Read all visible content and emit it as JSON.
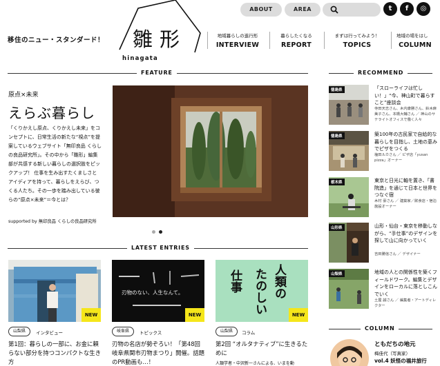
{
  "header": {
    "tagline": "移住のニュー・スタンダード！",
    "logo_text": "雛形",
    "logo_sub": "hinagata",
    "top_buttons": {
      "about": "ABOUT",
      "area": "AREA"
    },
    "social": {
      "twitter": "t",
      "facebook": "f",
      "other": "◎"
    },
    "nav": [
      {
        "sub": "地域暮らしの進行形",
        "label": "INTERVIEW"
      },
      {
        "sub": "暮らしたくなる",
        "label": "REPORT"
      },
      {
        "sub": "まずは行ってみよう！",
        "label": "TOPICS"
      },
      {
        "sub": "地域の場をはし",
        "label": "COLUMN"
      }
    ]
  },
  "feature": {
    "section_title": "FEATURE",
    "kicker": "原点×未来",
    "title": "えらぶ暮らし",
    "body": "「くりかえし原点、くりかえし未来」をコンセプトに、日常生活の新たな“視点”を提案しているウェブサイト「無印良品 くらしの良品研究所」。その中から「雛形」編集部が共感する新しい暮らしの選択肢をピックアップ！ 仕事を生み出すたくましさとアイディアを持って、暮らしをえらび、つくる人たち。その一歩を踏み出している彼らの“原点×未来”＝今とは？",
    "supported": "supported by 無印良品 くらしの良品研究所",
    "slide_count": 2,
    "active_slide": 2
  },
  "latest": {
    "section_title": "LATEST ENTRIES",
    "entries": [
      {
        "area": "山梨県",
        "category": "インタビュー",
        "title": "第1回：暮らしの一部に、お金に頼らない部分を持つコンパクトな生き方",
        "badge": "NEW"
      },
      {
        "area": "岐阜県",
        "category": "トピックス",
        "title": "刃物の名店が勢ぞろい！「第48回岐阜県関市刃物まつり」開催。話題のPR動画も…！",
        "badge": "NEW",
        "image_caption": "刃物のない、人生なんて。"
      },
      {
        "area": "山梨県",
        "category": "コラム",
        "title": "第2回 “オルタナティブ”に生きるために",
        "meta": "人類学者・中沢新一さんによる、いまを動",
        "badge": "NEW",
        "image_text": [
          "仕事",
          "人類の",
          "たのしい"
        ]
      }
    ]
  },
  "recommend": {
    "section_title": "RECOMMEND",
    "items": [
      {
        "area": "徳島県",
        "title": "「スローライフは忙しい！」“今、神山町で暮らすこと”座談会",
        "meta": "寺田天志さん、木内康勝さん、鈴木麻美子さん、本橋大輔さん ／ 神山のサテライトオフィスで働く人々"
      },
      {
        "area": "徳島県",
        "title": "築100年の古民家で自給的な暮らしを目指し、土地の恵みでピザをつくる",
        "meta": "塩田ルカさん ／ ピザ店「yusan pizza」オーナー"
      },
      {
        "area": "栃木県",
        "title": "東京と日光に軸を置き、「書院造」を通じて日本と世界をつなぐ宿",
        "meta": "木村 豪さん ／ 建築家／飲食店・宿泊施設オーナー"
      },
      {
        "area": "山形県",
        "title": "山形・仙台・東京を移動しながら、“手仕事”のデザインを探して山に向かっていく",
        "meta": "吉田勝信さん ／ デザイナー"
      },
      {
        "area": "山梨県",
        "title": "地域の人との関係性を築くフィールドワーク。編集とデザインをローカルに落としこんでいく",
        "meta": "土屋 誠さん ／ 編集者・アートディレクター"
      }
    ]
  },
  "column": {
    "section_title": "COLUMN",
    "title": "ともだちの地元",
    "author": "梅佳代（写真家）",
    "episode": "vol.4 妖怪の福井旅行"
  }
}
